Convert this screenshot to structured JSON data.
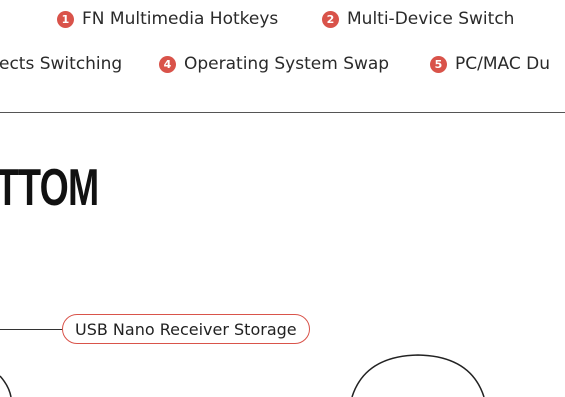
{
  "features": {
    "row1": [
      {
        "number": "1",
        "label": "FN Multimedia Hotkeys"
      },
      {
        "number": "2",
        "label": "Multi-Device Switch"
      }
    ],
    "row2": [
      {
        "number": "",
        "label": "ects Switching"
      },
      {
        "number": "4",
        "label": "Operating System Swap"
      },
      {
        "number": "5",
        "label": "PC/MAC Du"
      }
    ]
  },
  "heading": "TTOM",
  "callout": "USB Nano Receiver Storage",
  "colors": {
    "accent": "#d9534a",
    "text": "#222222",
    "divider": "#555555"
  }
}
